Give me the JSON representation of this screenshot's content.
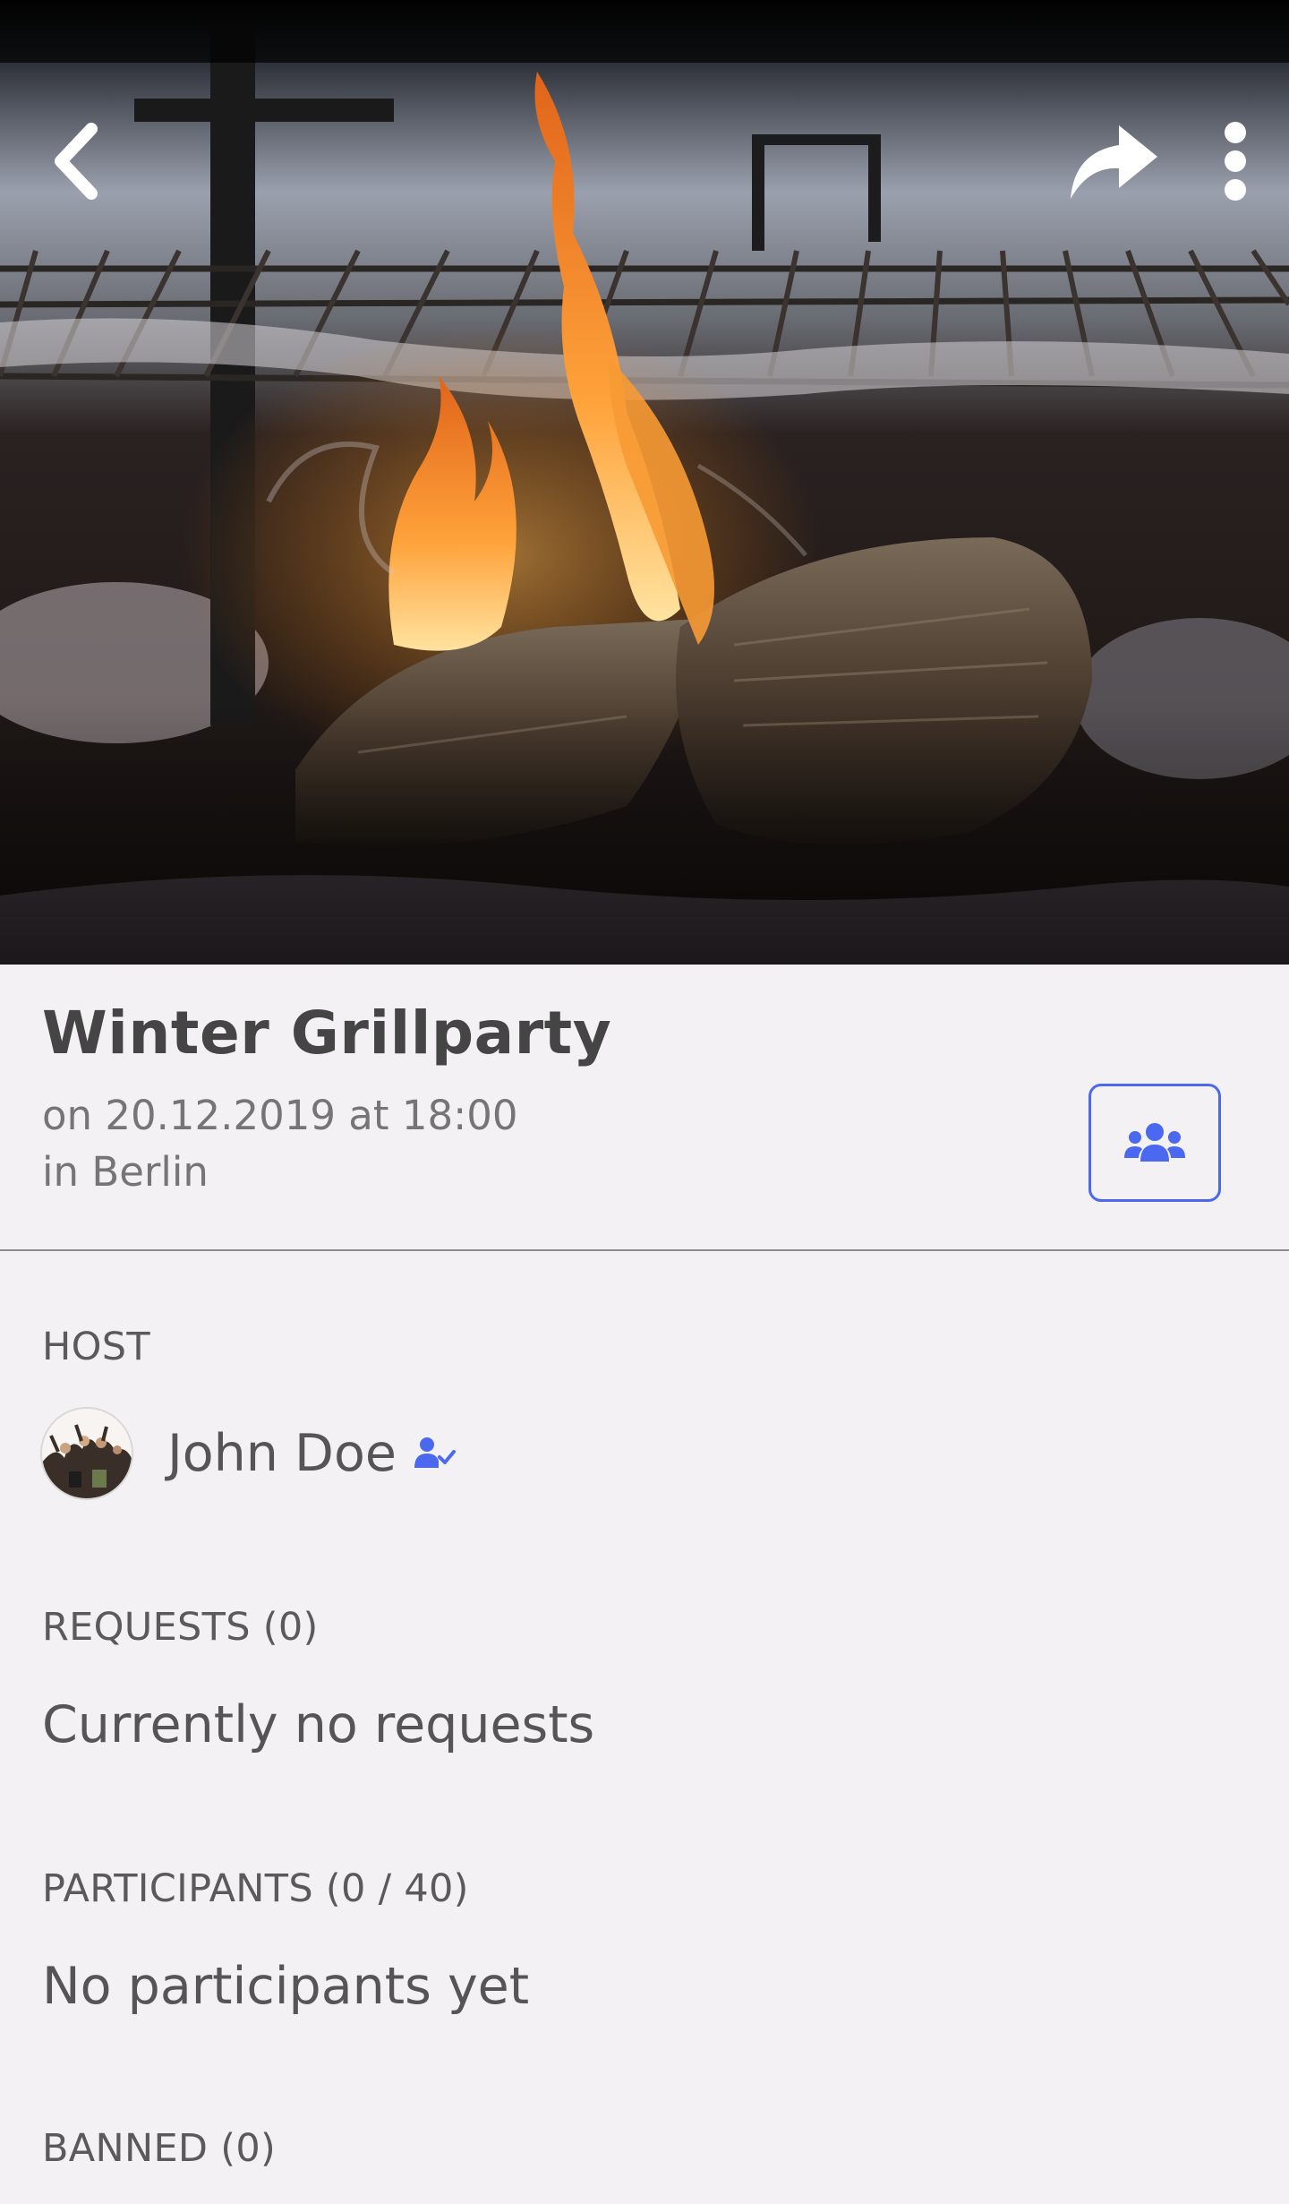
{
  "event": {
    "title": "Winter Grillparty",
    "date_line": "on 20.12.2019 at 18:00",
    "location_line": "in Berlin"
  },
  "host": {
    "label": "HOST",
    "name": "John Doe"
  },
  "requests": {
    "label": "REQUESTS (0)",
    "empty_text": "Currently no requests"
  },
  "participants": {
    "label": "PARTICIPANTS (0 / 40)",
    "empty_text": "No participants yet"
  },
  "banned": {
    "label": "BANNED (0)"
  },
  "icons": {
    "back": "chevron-left-icon",
    "share": "share-arrow-icon",
    "more": "more-vertical-icon",
    "group": "users-group-icon",
    "verified": "user-check-icon"
  },
  "colors": {
    "accent": "#4a68f0",
    "background": "#f3f1f3",
    "title": "#454545",
    "muted": "#757575"
  }
}
